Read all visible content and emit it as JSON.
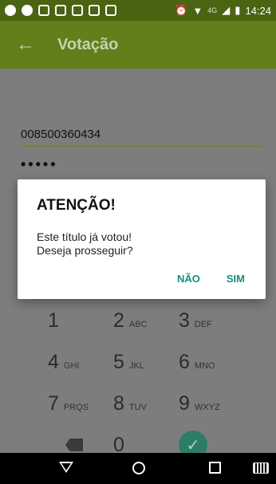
{
  "status_bar": {
    "network": "4G",
    "time": "14:24"
  },
  "app_bar": {
    "title": "Votação"
  },
  "form": {
    "voter_id": "008500360434",
    "pin_masked": "•••••"
  },
  "dialog": {
    "title": "ATENÇÃO!",
    "message_line1": "Este título já votou!",
    "message_line2": "Deseja prosseguir?",
    "negative_label": "NÃO",
    "positive_label": "SIM"
  },
  "keypad": {
    "rows": [
      [
        {
          "num": "1",
          "letters": ""
        },
        {
          "num": "2",
          "letters": "ABC"
        },
        {
          "num": "3",
          "letters": "DEF"
        }
      ],
      [
        {
          "num": "4",
          "letters": "GHI"
        },
        {
          "num": "5",
          "letters": "JKL"
        },
        {
          "num": "6",
          "letters": "MNO"
        }
      ],
      [
        {
          "num": "7",
          "letters": "PRQS"
        },
        {
          "num": "8",
          "letters": "TUV"
        },
        {
          "num": "9",
          "letters": "WXYZ"
        }
      ]
    ],
    "zero": "0"
  },
  "colors": {
    "accent": "#617f1b",
    "status": "#4a6412",
    "dialog_button": "#13907c"
  }
}
